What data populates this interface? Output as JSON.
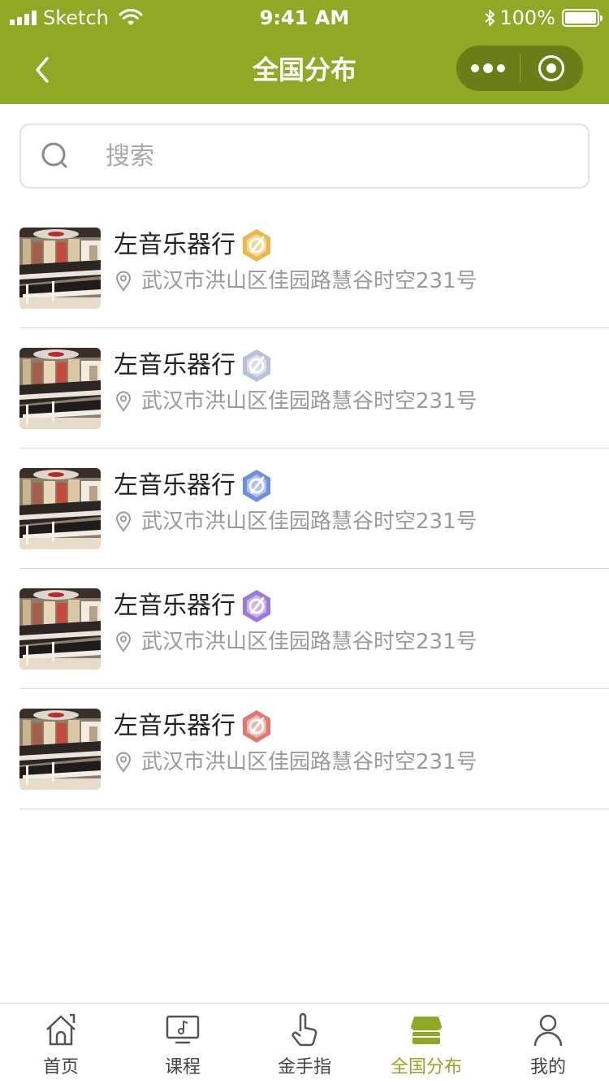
{
  "status_bar": {
    "carrier": "Sketch",
    "time": "9:41 AM",
    "battery": "100%"
  },
  "nav": {
    "title": "全国分布"
  },
  "search": {
    "placeholder": "搜索"
  },
  "stores": [
    {
      "name": "左音乐器行",
      "address": "武汉市洪山区佳园路慧谷时空231号",
      "badge": "gold-badge-icon"
    },
    {
      "name": "左音乐器行",
      "address": "武汉市洪山区佳园路慧谷时空231号",
      "badge": "silver-badge-icon"
    },
    {
      "name": "左音乐器行",
      "address": "武汉市洪山区佳园路慧谷时空231号",
      "badge": "blue-badge-icon"
    },
    {
      "name": "左音乐器行",
      "address": "武汉市洪山区佳园路慧谷时空231号",
      "badge": "purple-badge-icon"
    },
    {
      "name": "左音乐器行",
      "address": "武汉市洪山区佳园路慧谷时空231号",
      "badge": "red-badge-icon"
    }
  ],
  "tabs": [
    {
      "label": "首页",
      "icon": "home-icon",
      "active": false
    },
    {
      "label": "课程",
      "icon": "course-monitor-icon",
      "active": false
    },
    {
      "label": "金手指",
      "icon": "pointing-hand-icon",
      "active": false
    },
    {
      "label": "全国分布",
      "icon": "store-icon",
      "active": true
    },
    {
      "label": "我的",
      "icon": "user-icon",
      "active": false
    }
  ],
  "colors": {
    "accent": "#8fa826",
    "badge_gold": "#e8b84a",
    "badge_silver": "#b8c2d6",
    "badge_blue": "#6f8fe0",
    "badge_purple": "#9b7ad8",
    "badge_red": "#e07a6e"
  }
}
